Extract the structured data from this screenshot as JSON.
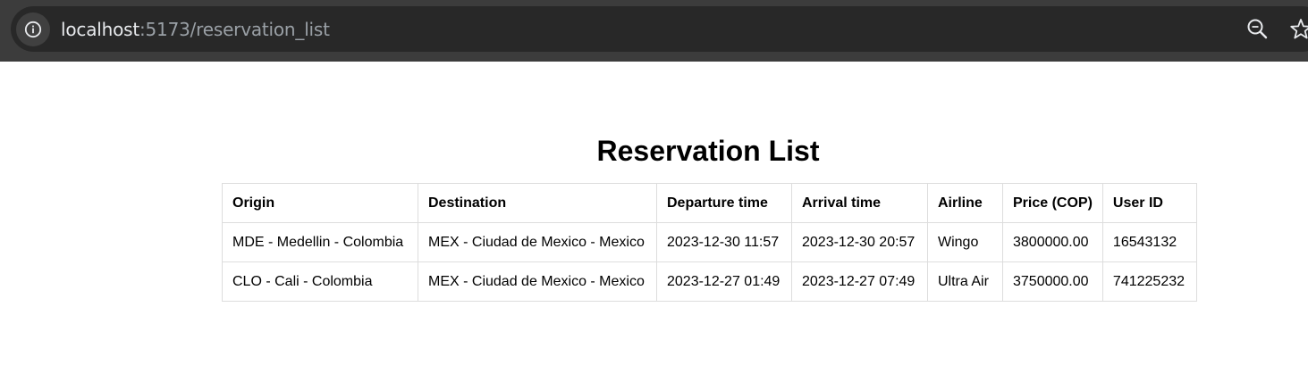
{
  "browser": {
    "url_host": "localhost",
    "url_path": ":5173/reservation_list",
    "icons": [
      "info-icon",
      "zoom-icon",
      "star-icon"
    ]
  },
  "page": {
    "title": "Reservation List"
  },
  "table": {
    "headers": [
      "Origin",
      "Destination",
      "Departure time",
      "Arrival time",
      "Airline",
      "Price (COP)",
      "User ID"
    ],
    "rows": [
      [
        "MDE - Medellin - Colombia",
        "MEX - Ciudad de Mexico - Mexico",
        "2023-12-30 11:57",
        "2023-12-30 20:57",
        "Wingo",
        "3800000.00",
        "16543132"
      ],
      [
        "CLO - Cali - Colombia",
        "MEX - Ciudad de Mexico - Mexico",
        "2023-12-27 01:49",
        "2023-12-27 07:49",
        "Ultra Air",
        "3750000.00",
        "741225232"
      ]
    ]
  }
}
